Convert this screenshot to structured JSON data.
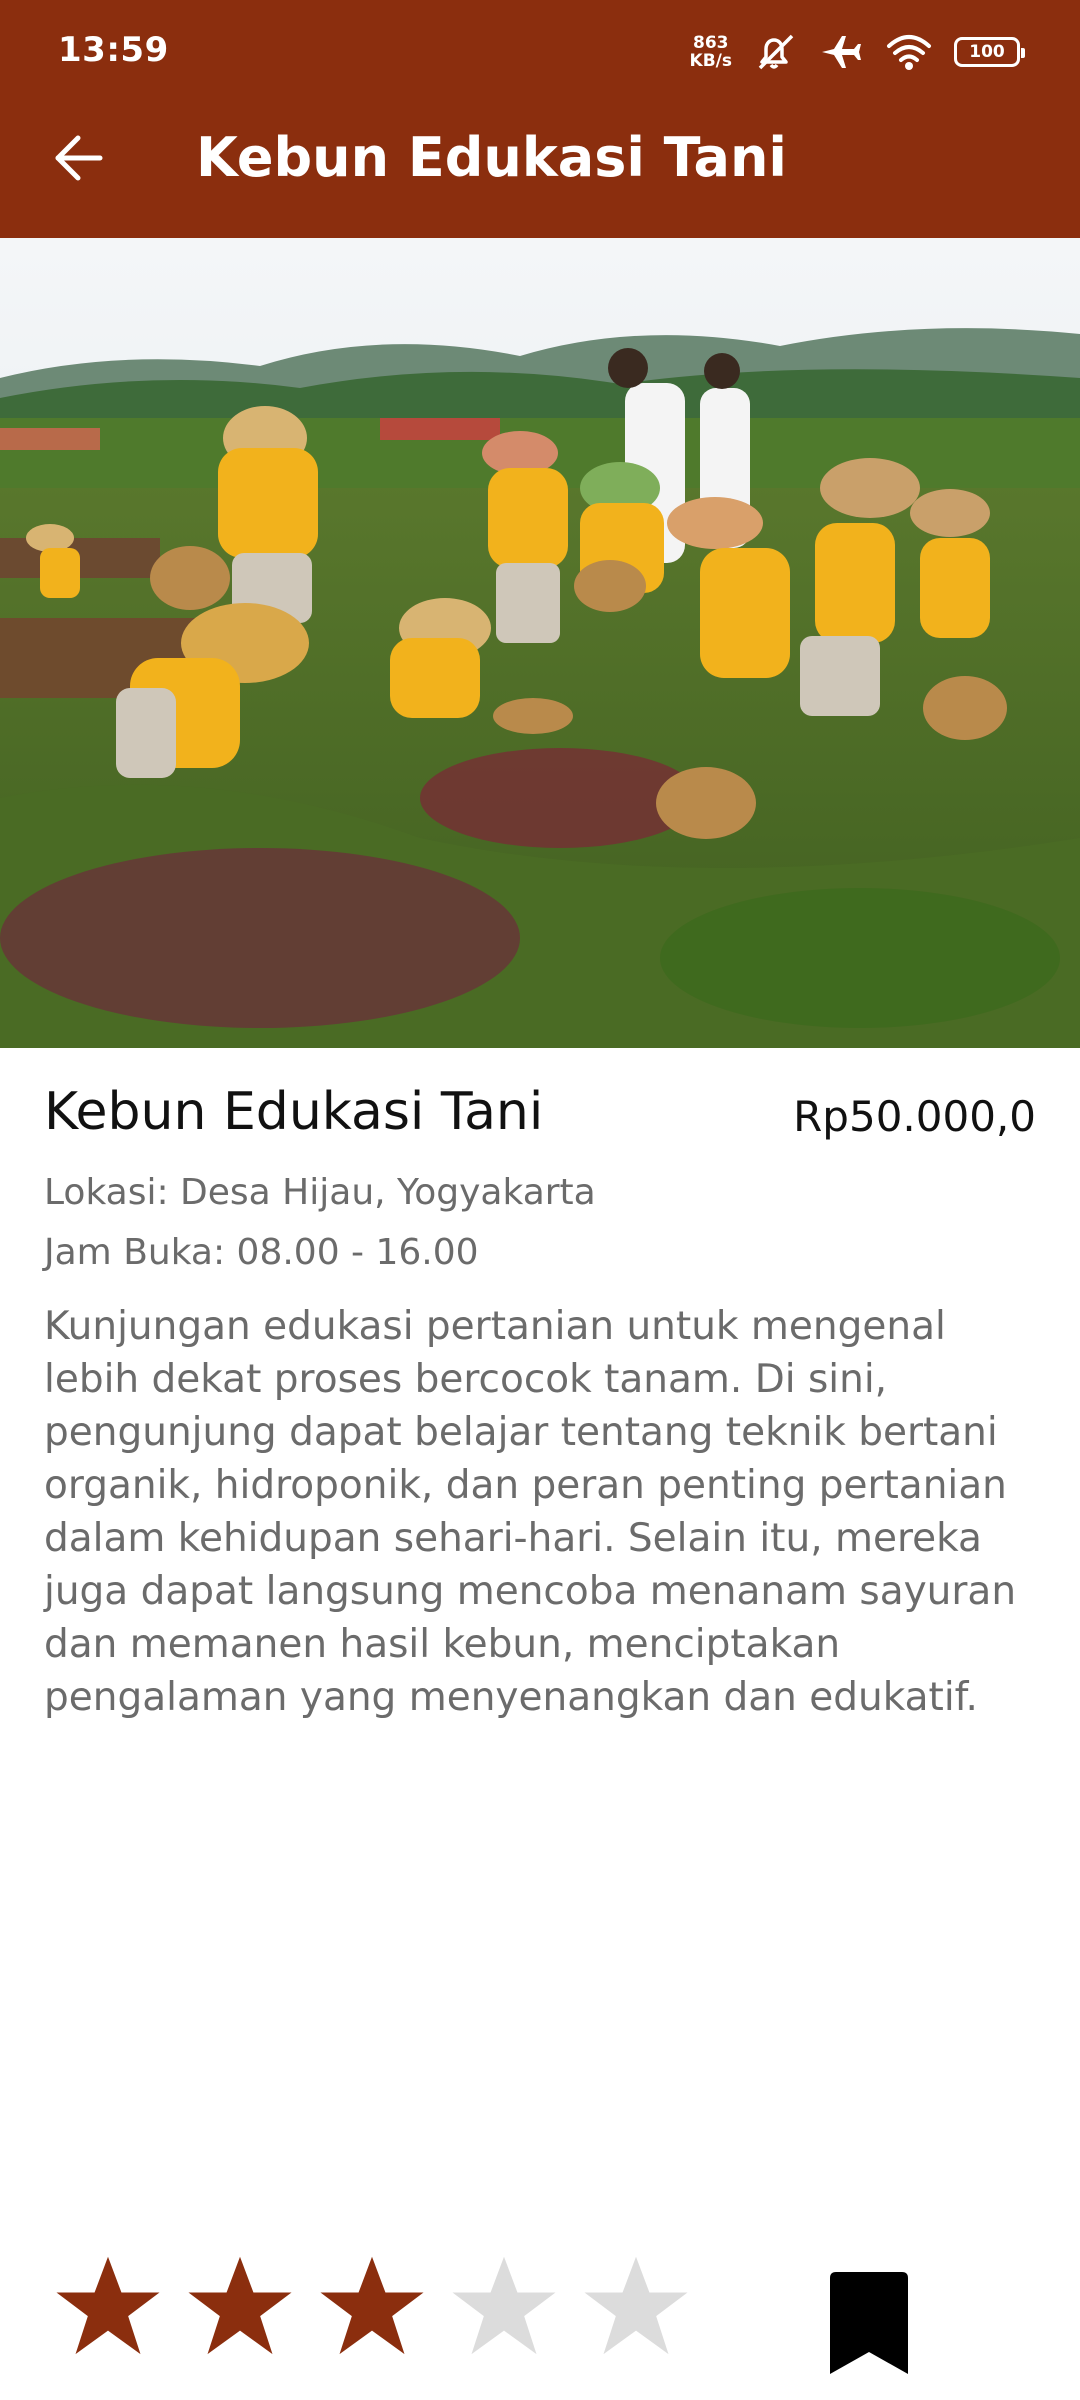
{
  "status_bar": {
    "time": "13:59",
    "net_speed_value": "863",
    "net_speed_unit": "KB/s",
    "battery": "100",
    "icons": [
      "mute-icon",
      "airplane-icon",
      "wifi-icon",
      "battery-icon"
    ]
  },
  "appbar": {
    "title": "Kebun Edukasi Tani",
    "back_icon": "arrow-left-icon",
    "color": "#8b2e0e"
  },
  "place": {
    "name": "Kebun Edukasi Tani",
    "price": "Rp50.000,0",
    "location": "Lokasi: Desa Hijau, Yogyakarta",
    "hours": "Jam Buka: 08.00 - 16.00",
    "description": "Kunjungan edukasi pertanian untuk mengenal lebih dekat proses bercocok tanam. Di sini, pengunjung dapat belajar tentang teknik bertani organik, hidroponik, dan peran penting pertanian dalam kehidupan sehari-hari. Selain itu, mereka juga dapat langsung mencoba menanam sayuran dan memanen hasil kebun, menciptakan pengalaman yang menyenangkan dan edukatif."
  },
  "rating": {
    "value": 3,
    "max": 5,
    "filled_color": "#8b2e0e",
    "empty_color": "#dcdcdc"
  },
  "bookmark": {
    "icon": "bookmark-icon",
    "color": "#000000"
  }
}
